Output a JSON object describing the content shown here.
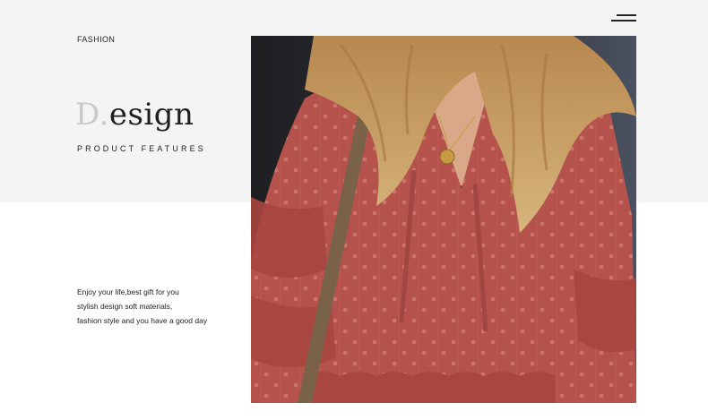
{
  "header": {
    "section_label": "FASHION"
  },
  "hero": {
    "title_initial": "D.",
    "title_rest": "esign",
    "subtitle": "PRODUCT FEATURES"
  },
  "description": {
    "lines": [
      "Enjoy your life,best gift for you",
      "stylish design soft materials,",
      "fashion style and you have a good day"
    ]
  },
  "colors": {
    "background_top": "#f4f4f4",
    "background_bottom": "#ffffff",
    "blouse": "#b5524c",
    "hair": "#c9a56e",
    "text": "#222222"
  },
  "icons": {
    "menu": "hamburger-menu-icon"
  }
}
